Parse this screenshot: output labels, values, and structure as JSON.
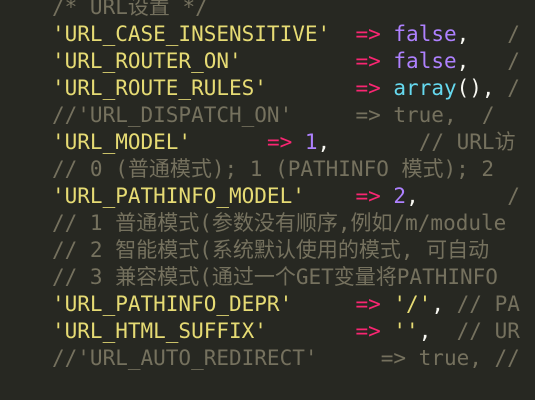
{
  "editor": {
    "theme": "monokai",
    "colors": {
      "background": "#272822",
      "string": "#E6DB74",
      "operator": "#F92672",
      "boolean": "#AE81FF",
      "number": "#AE81FF",
      "function": "#66D9EF",
      "punctuation": "#F8F8F2",
      "comment": "#75715E"
    },
    "lines": [
      {
        "name": "code-line-url-settings-comment",
        "tokens": [
          {
            "type": "comment",
            "text": "/* URL设置 */"
          }
        ]
      },
      {
        "name": "code-line-url-case-insensitive",
        "tokens": [
          {
            "type": "str",
            "text": "'URL_CASE_INSENSITIVE'"
          },
          {
            "type": "sp",
            "text": "  "
          },
          {
            "type": "op",
            "text": "=>"
          },
          {
            "type": "sp",
            "text": " "
          },
          {
            "type": "bool",
            "text": "false"
          },
          {
            "type": "punc",
            "text": ","
          },
          {
            "type": "sp",
            "text": "   "
          },
          {
            "type": "comment",
            "text": "/"
          }
        ]
      },
      {
        "name": "code-line-url-router-on",
        "tokens": [
          {
            "type": "str",
            "text": "'URL_ROUTER_ON'"
          },
          {
            "type": "sp",
            "text": "         "
          },
          {
            "type": "op",
            "text": "=>"
          },
          {
            "type": "sp",
            "text": " "
          },
          {
            "type": "bool",
            "text": "false"
          },
          {
            "type": "punc",
            "text": ","
          },
          {
            "type": "sp",
            "text": "   "
          },
          {
            "type": "comment",
            "text": "/"
          }
        ]
      },
      {
        "name": "code-line-url-route-rules",
        "tokens": [
          {
            "type": "str",
            "text": "'URL_ROUTE_RULES'"
          },
          {
            "type": "sp",
            "text": "       "
          },
          {
            "type": "op",
            "text": "=>"
          },
          {
            "type": "sp",
            "text": " "
          },
          {
            "type": "func",
            "text": "array"
          },
          {
            "type": "punc",
            "text": "(),"
          },
          {
            "type": "sp",
            "text": " "
          },
          {
            "type": "comment",
            "text": "/"
          }
        ]
      },
      {
        "name": "code-line-url-dispatch-on-comment",
        "tokens": [
          {
            "type": "comment",
            "text": "//'URL_DISPATCH_ON'"
          },
          {
            "type": "sp",
            "text": "     "
          },
          {
            "type": "comment",
            "text": "=> true,  /"
          }
        ]
      },
      {
        "name": "code-line-url-model",
        "tokens": [
          {
            "type": "str",
            "text": "'URL_MODEL'"
          },
          {
            "type": "sp",
            "text": "      "
          },
          {
            "type": "op",
            "text": "=>"
          },
          {
            "type": "sp",
            "text": " "
          },
          {
            "type": "num",
            "text": "1"
          },
          {
            "type": "punc",
            "text": ","
          },
          {
            "type": "sp",
            "text": "       "
          },
          {
            "type": "comment",
            "text": "// URL访"
          }
        ]
      },
      {
        "name": "code-line-url-model-options-comment",
        "tokens": [
          {
            "type": "comment",
            "text": "// 0 (普通模式); 1 (PATHINFO 模式); 2"
          }
        ]
      },
      {
        "name": "code-line-url-pathinfo-model",
        "tokens": [
          {
            "type": "str",
            "text": "'URL_PATHINFO_MODEL'"
          },
          {
            "type": "sp",
            "text": "    "
          },
          {
            "type": "op",
            "text": "=>"
          },
          {
            "type": "sp",
            "text": " "
          },
          {
            "type": "num",
            "text": "2"
          },
          {
            "type": "punc",
            "text": ","
          },
          {
            "type": "sp",
            "text": "       "
          },
          {
            "type": "comment",
            "text": "/"
          }
        ]
      },
      {
        "name": "code-line-pathinfo-mode-1-comment",
        "tokens": [
          {
            "type": "comment",
            "text": "// 1 普通模式(参数没有顺序,例如/m/module"
          }
        ]
      },
      {
        "name": "code-line-pathinfo-mode-2-comment",
        "tokens": [
          {
            "type": "comment",
            "text": "// 2 智能模式(系统默认使用的模式, 可自动"
          }
        ]
      },
      {
        "name": "code-line-pathinfo-mode-3-comment",
        "tokens": [
          {
            "type": "comment",
            "text": "// 3 兼容模式(通过一个GET变量将PATHINFO"
          }
        ]
      },
      {
        "name": "code-line-url-pathinfo-depr",
        "tokens": [
          {
            "type": "str",
            "text": "'URL_PATHINFO_DEPR'"
          },
          {
            "type": "sp",
            "text": "     "
          },
          {
            "type": "op",
            "text": "=>"
          },
          {
            "type": "sp",
            "text": " "
          },
          {
            "type": "str",
            "text": "'/'"
          },
          {
            "type": "punc",
            "text": ","
          },
          {
            "type": "sp",
            "text": " "
          },
          {
            "type": "comment",
            "text": "// PA"
          }
        ]
      },
      {
        "name": "code-line-url-html-suffix",
        "tokens": [
          {
            "type": "str",
            "text": "'URL_HTML_SUFFIX'"
          },
          {
            "type": "sp",
            "text": "       "
          },
          {
            "type": "op",
            "text": "=>"
          },
          {
            "type": "sp",
            "text": " "
          },
          {
            "type": "str",
            "text": "''"
          },
          {
            "type": "punc",
            "text": ","
          },
          {
            "type": "sp",
            "text": "  "
          },
          {
            "type": "comment",
            "text": "// UR"
          }
        ]
      },
      {
        "name": "code-line-url-auto-redirect-comment",
        "tokens": [
          {
            "type": "comment",
            "text": "//'URL_AUTO_REDIRECT'"
          },
          {
            "type": "sp",
            "text": "     "
          },
          {
            "type": "comment",
            "text": "=> true, //"
          }
        ]
      }
    ]
  }
}
